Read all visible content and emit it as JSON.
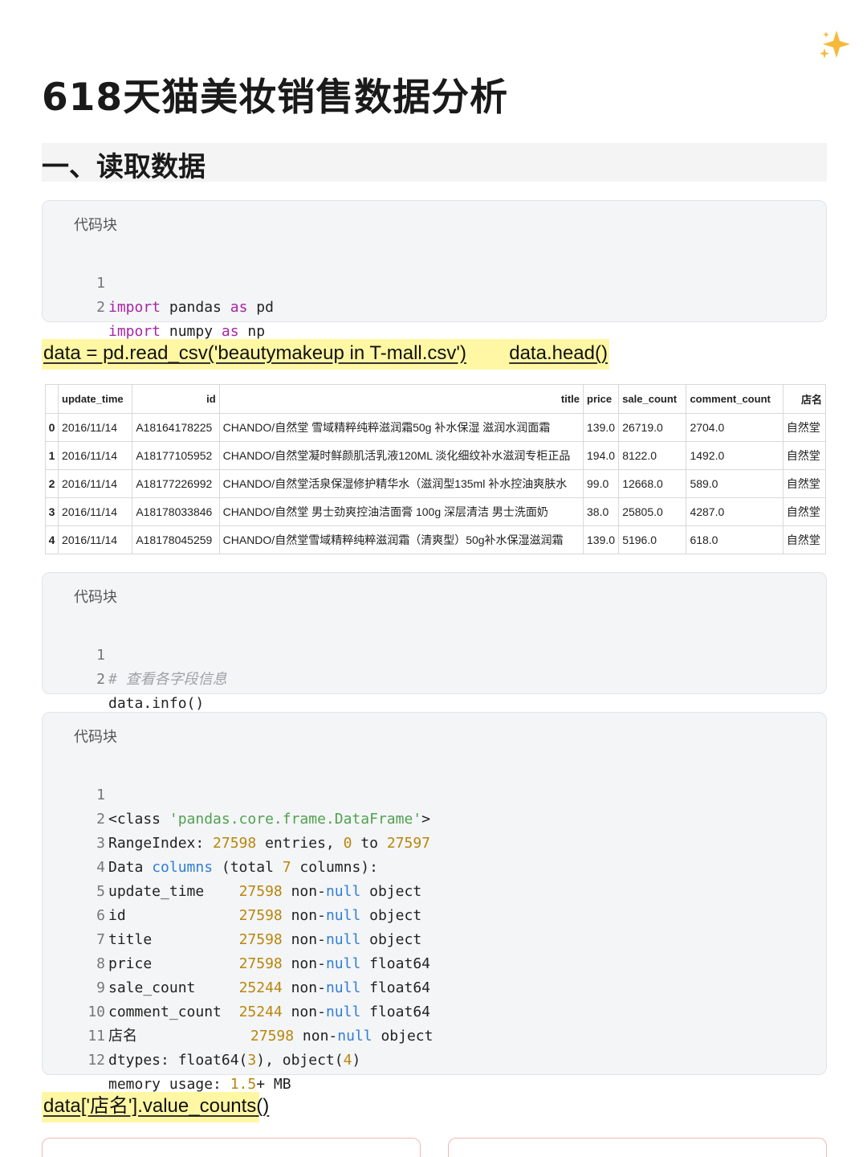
{
  "page_title": "618天猫美妆销售数据分析",
  "section_heading": "一、读取数据",
  "code_blocks": {
    "label": "代码块",
    "block1": [
      {
        "n": "1",
        "kw": "import",
        "t1": " pandas ",
        "kw2": "as",
        "t2": " pd"
      },
      {
        "n": "2",
        "kw": "import",
        "t1": " numpy ",
        "kw2": "as",
        "t2": " np"
      }
    ],
    "block2": [
      {
        "n": "1",
        "comment": "# 查看各字段信息"
      },
      {
        "n": "2",
        "text": "data.info()"
      }
    ],
    "block3_numbers": [
      "1",
      "2",
      "3",
      "4",
      "5",
      "6",
      "7",
      "8",
      "9",
      "10",
      "11",
      "12"
    ],
    "block3": {
      "l1a": "<class ",
      "l1s": "'pandas.core.frame.DataFrame'",
      "l1b": ">",
      "l2a": "RangeIndex: ",
      "l2n1": "27598",
      "l2b": " entries, ",
      "l2n2": "0",
      "l2c": " to ",
      "l2n3": "27597",
      "l3a": "Data ",
      "l3k": "columns",
      "l3b": " (total ",
      "l3n": "7",
      "l3c": " columns):",
      "fields": [
        {
          "name": "update_time    ",
          "count": "27598",
          "nn1": " non-",
          "nn2": "null",
          "dtype": " object"
        },
        {
          "name": "id             ",
          "count": "27598",
          "nn1": " non-",
          "nn2": "null",
          "dtype": " object"
        },
        {
          "name": "title          ",
          "count": "27598",
          "nn1": " non-",
          "nn2": "null",
          "dtype": " object"
        },
        {
          "name": "price          ",
          "count": "27598",
          "nn1": " non-",
          "nn2": "null",
          "dtype": " float64"
        },
        {
          "name": "sale_count     ",
          "count": "25244",
          "nn1": " non-",
          "nn2": "null",
          "dtype": " float64"
        },
        {
          "name": "comment_count  ",
          "count": "25244",
          "nn1": " non-",
          "nn2": "null",
          "dtype": " float64"
        },
        {
          "name": "店名             ",
          "count": "27598",
          "nn1": " non-",
          "nn2": "null",
          "dtype": " object"
        }
      ],
      "l11a": "dtypes: float64(",
      "l11n1": "3",
      "l11b": "), object(",
      "l11n2": "4",
      "l11c": ")",
      "l12a": "memory usage: ",
      "l12n": "1.5",
      "l12b": "+ MB"
    }
  },
  "highlights": {
    "read_csv": "data = pd.read_csv('beautymakeup in T-mall.csv')",
    "head": "data.head()",
    "value_counts": "data['店名'].value_counts()"
  },
  "table": {
    "columns": [
      "",
      "update_time",
      "id",
      "title",
      "price",
      "sale_count",
      "comment_count",
      "店名"
    ],
    "rows": [
      [
        "0",
        "2016/11/14",
        "A18164178225",
        "CHANDO/自然堂 雪域精粹纯粹滋润霜50g 补水保湿 滋润水润面霜",
        "139.0",
        "26719.0",
        "2704.0",
        "自然堂"
      ],
      [
        "1",
        "2016/11/14",
        "A18177105952",
        "CHANDO/自然堂凝时鲜颜肌活乳液120ML 淡化细纹补水滋润专柜正品",
        "194.0",
        "8122.0",
        "1492.0",
        "自然堂"
      ],
      [
        "2",
        "2016/11/14",
        "A18177226992",
        "CHANDO/自然堂活泉保湿修护精华水（滋润型135ml 补水控油爽肤水",
        "99.0",
        "12668.0",
        "589.0",
        "自然堂"
      ],
      [
        "3",
        "2016/11/14",
        "A18178033846",
        "CHANDO/自然堂 男士劲爽控油洁面膏 100g 深层清洁 男士洗面奶",
        "38.0",
        "25805.0",
        "4287.0",
        "自然堂"
      ],
      [
        "4",
        "2016/11/14",
        "A18178045259",
        "CHANDO/自然堂雪域精粹纯粹滋润霜（清爽型）50g补水保湿滋润霜",
        "139.0",
        "5196.0",
        "618.0",
        "自然堂"
      ]
    ]
  },
  "colors": {
    "highlight": "#fff7a3",
    "keyword": "#a626a4",
    "string": "#50a14f",
    "number": "#b8860b",
    "builtin": "#2f7dd6"
  },
  "icons": {
    "sparkle": "sparkle-icon"
  }
}
